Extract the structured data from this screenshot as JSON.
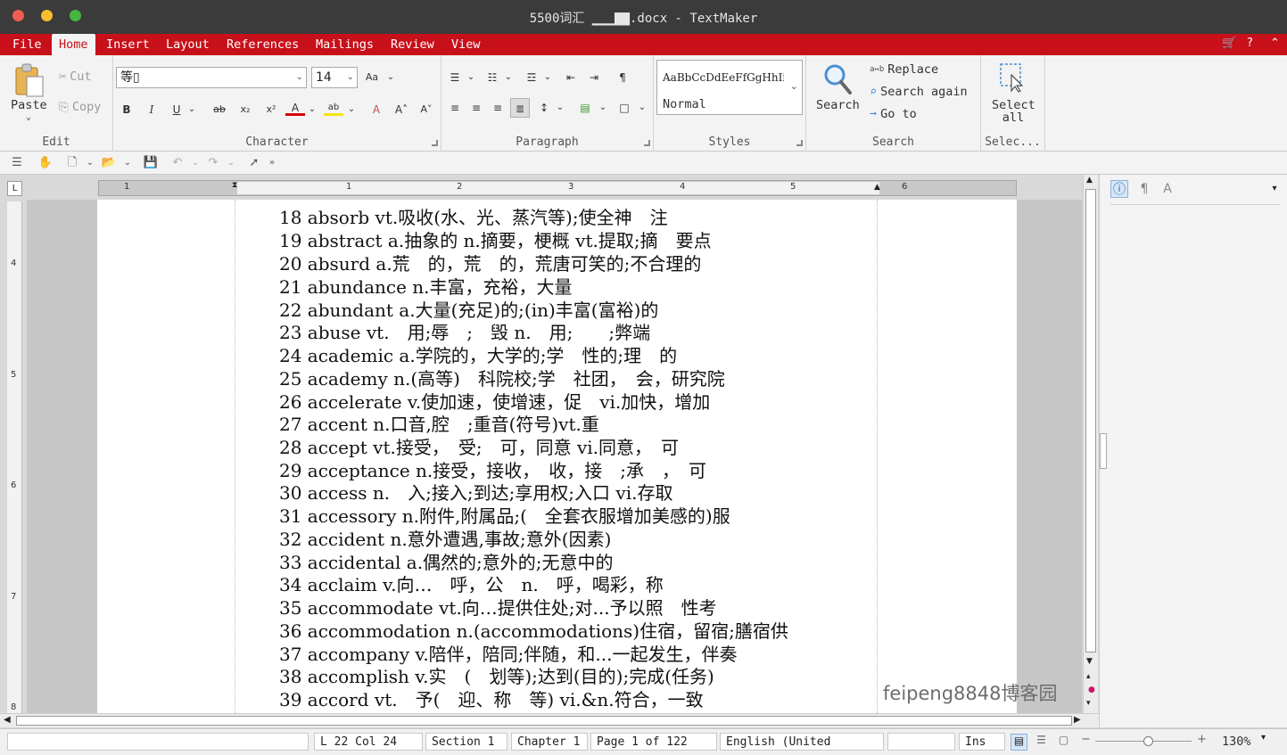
{
  "window": {
    "title": "5500词汇 ▁▁▁▇▇.docx - TextMaker"
  },
  "menu": {
    "items": [
      "File",
      "Home",
      "Insert",
      "Layout",
      "References",
      "Mailings",
      "Review",
      "View"
    ],
    "active": "Home"
  },
  "ribbon": {
    "edit": {
      "label": "Edit",
      "paste": "Paste",
      "cut": "Cut",
      "copy": "Copy"
    },
    "character": {
      "label": "Character",
      "font": "等▯",
      "size": "14"
    },
    "paragraph": {
      "label": "Paragraph"
    },
    "styles": {
      "label": "Styles",
      "preview": "AaBbCcDdEeFfGgHhIi",
      "current": "Normal"
    },
    "search": {
      "label": "Search",
      "search": "Search",
      "replace": "Replace",
      "search_again": "Search again",
      "goto": "Go to"
    },
    "select": {
      "label": "Selec...",
      "select_line1": "Select",
      "select_line2": "all"
    }
  },
  "ruler": {
    "h_numbers": [
      "1",
      "1",
      "2",
      "3",
      "4",
      "5",
      "6"
    ],
    "v_numbers": [
      "4",
      "5",
      "6",
      "7",
      "8"
    ]
  },
  "document": {
    "lines": [
      "18 absorb vt.吸收(水、光、蒸汽等);使全神　注",
      "19 abstract a.抽象的 n.摘要，梗概 vt.提取;摘　要点",
      "20 absurd a.荒　的，荒　的，荒唐可笑的;不合理的",
      "21 abundance n.丰富，充裕，大量",
      "22 abundant a.大量(充足)的;(in)丰富(富裕)的",
      "23 abuse vt.　用;辱　;　毁 n.　用;　　;弊端",
      "24 academic a.学院的，大学的;学　性的;理　的",
      "25 academy n.(高等)　科院校;学　社团，　会，研究院",
      "26 accelerate v.使加速，使增速，促　vi.加快，增加",
      "27 accent n.口音,腔　;重音(符号)vt.重",
      "28 accept vt.接受，　受;　可，同意 vi.同意，　可",
      "29 acceptance n.接受，接收，　收，接　;承　，　可",
      "30 access n.　入;接入;到达;享用权;入口 vi.存取",
      "31 accessory n.附件,附属品;(　全套衣服增加美感的)服",
      "32 accident n.意外遭遇,事故;意外(因素)",
      "33 accidental a.偶然的;意外的;无意中的",
      "34 acclaim v.向…　呼，公　n.　呼，喝彩，称",
      "35 accommodate vt.向…提供住处;对...予以照　性考",
      "36 accommodation n.(accommodations)住宿，留宿;膳宿供",
      "37 accompany v.陪伴，陪同;伴随，和...一起发生，伴奏",
      "38 accomplish v.实　(　划等);达到(目的);完成(任务)",
      "39 accord vt.　予(　迎、称　等) vi.&n.符合，一致"
    ]
  },
  "watermark": "feipeng8848博客园",
  "status": {
    "position": "L 22 Col 24",
    "section": "Section 1",
    "chapter": "Chapter 1",
    "page": "Page 1 of 122",
    "language": "English (United",
    "mode": "Ins",
    "zoom": "130%"
  }
}
